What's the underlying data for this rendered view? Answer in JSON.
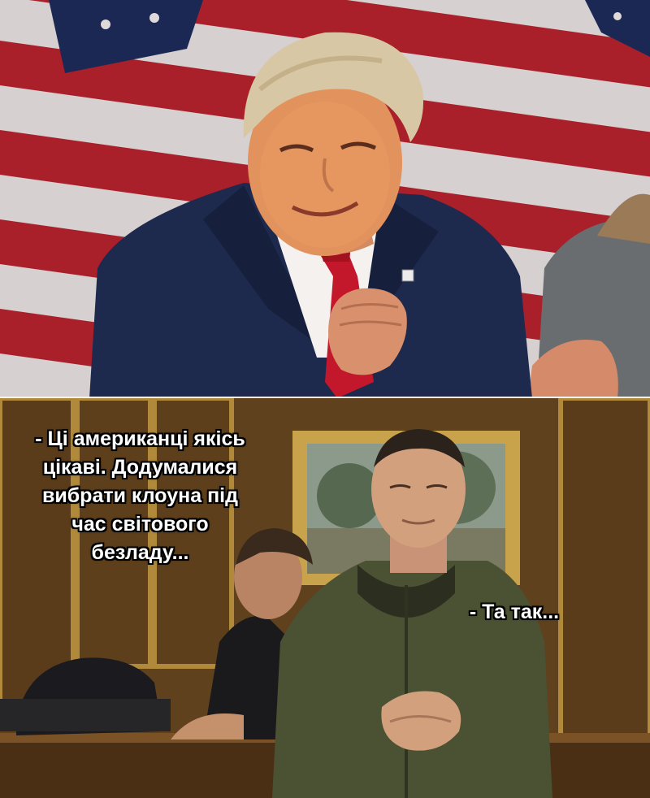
{
  "panels": {
    "top": {
      "icon": "man-at-flag-backdrop-illustration"
    },
    "bottom": {
      "icon": "two-men-in-office-illustration"
    }
  },
  "captions": {
    "first_lines": [
      "- Ці американці якісь",
      "цікаві. Додумалися",
      "вибрати клоуна під",
      "час світового",
      "безладу..."
    ],
    "second": "- Та так..."
  },
  "colors": {
    "caption_text": "#ffffff",
    "caption_outline": "#000000",
    "flag_red": "#b8232f",
    "flag_white": "#f3ecec",
    "flag_blue": "#1f2c5c",
    "suit_navy": "#1d2a4d",
    "jacket_olive": "#4b5233",
    "panel_wood": "#6b4a22"
  }
}
